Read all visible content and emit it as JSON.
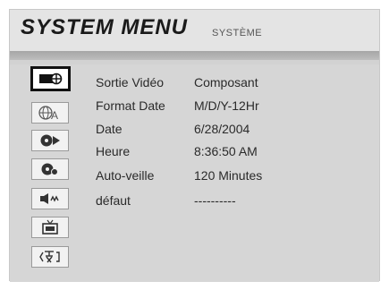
{
  "header": {
    "title": "SYSTEM MENU",
    "subtitle": "SYSTÈME"
  },
  "sidebar": {
    "items": [
      {
        "icon": "av-connector-icon",
        "selected": true
      },
      {
        "icon": "globe-language-icon",
        "selected": false
      },
      {
        "icon": "disc-play-icon",
        "selected": false
      },
      {
        "icon": "disc-record-icon",
        "selected": false
      },
      {
        "icon": "speaker-audio-icon",
        "selected": false
      },
      {
        "icon": "tv-display-icon",
        "selected": false
      },
      {
        "icon": "exit-return-icon",
        "selected": false
      }
    ]
  },
  "settings": [
    {
      "label": "Sortie Vidéo",
      "value": "Composant"
    },
    {
      "label": "Format Date",
      "value": "M/D/Y-12Hr"
    },
    {
      "label": "Date",
      "value": "6/28/2004"
    },
    {
      "label": "Heure",
      "value": "8:36:50 AM"
    },
    {
      "label": "Auto-veille",
      "value": "120 Minutes"
    },
    {
      "label": "défaut",
      "value": "----------"
    }
  ]
}
